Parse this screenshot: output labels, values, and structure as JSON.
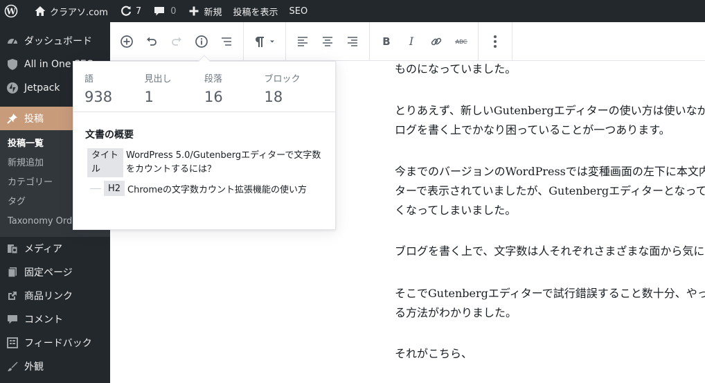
{
  "admin_bar": {
    "site_name": "クラアソ.com",
    "updates_count": "7",
    "comments_count": "0",
    "new_label": "新規",
    "view_posts_label": "投稿を表示",
    "seo_label": "SEO"
  },
  "sidebar": {
    "items": [
      {
        "label": "ダッシュボード",
        "icon": "dashboard-icon"
      },
      {
        "label": "All in One SEO",
        "icon": "shield-icon"
      },
      {
        "label": "Jetpack",
        "icon": "jetpack-icon"
      },
      {
        "label": "投稿",
        "icon": "pin-icon"
      },
      {
        "label": "メディア",
        "icon": "media-icon"
      },
      {
        "label": "固定ページ",
        "icon": "page-icon"
      },
      {
        "label": "商品リンク",
        "icon": "external-link-icon"
      },
      {
        "label": "コメント",
        "icon": "comment-icon"
      },
      {
        "label": "フィードバック",
        "icon": "feedback-icon"
      },
      {
        "label": "外観",
        "icon": "brush-icon"
      }
    ],
    "submenu": [
      "投稿一覧",
      "新規追加",
      "カテゴリー",
      "タグ",
      "Taxonomy Order"
    ]
  },
  "info": {
    "stats": [
      {
        "label": "語",
        "value": "938"
      },
      {
        "label": "見出し",
        "value": "1"
      },
      {
        "label": "段落",
        "value": "16"
      },
      {
        "label": "ブロック",
        "value": "18"
      }
    ],
    "outline_title": "文書の概要",
    "outline": [
      {
        "level": "タイトル",
        "text": "WordPress 5.0/Gutenbergエディターで文字数をカウントするには？"
      },
      {
        "level": "H2",
        "text": "Chromeの文字数カウント拡張機能の使い方"
      }
    ]
  },
  "content": {
    "lines": [
      "ものになっていました。",
      "とりあえず、新しいGutenbergエディターの使い方は使いながら",
      "ログを書く上でかなり困っていることが一つあります。",
      "今までのバージョンのWordPressでは変種画面の左下に本文内",
      "ターで表示されていましたが、Gutenbergエディターとなって",
      "くなってしまいました。",
      "ブログを書く上で、文字数は人それぞれさまざまな面から気に",
      "そこでGutenbergエディターで試行錯誤すること数十分、やっ",
      "る方法がわかりました。",
      "それがこちら、"
    ]
  },
  "colors": {
    "admin_bg": "#23282d",
    "sidebar_sub_bg": "#32373c",
    "accent": "#0073aa"
  }
}
